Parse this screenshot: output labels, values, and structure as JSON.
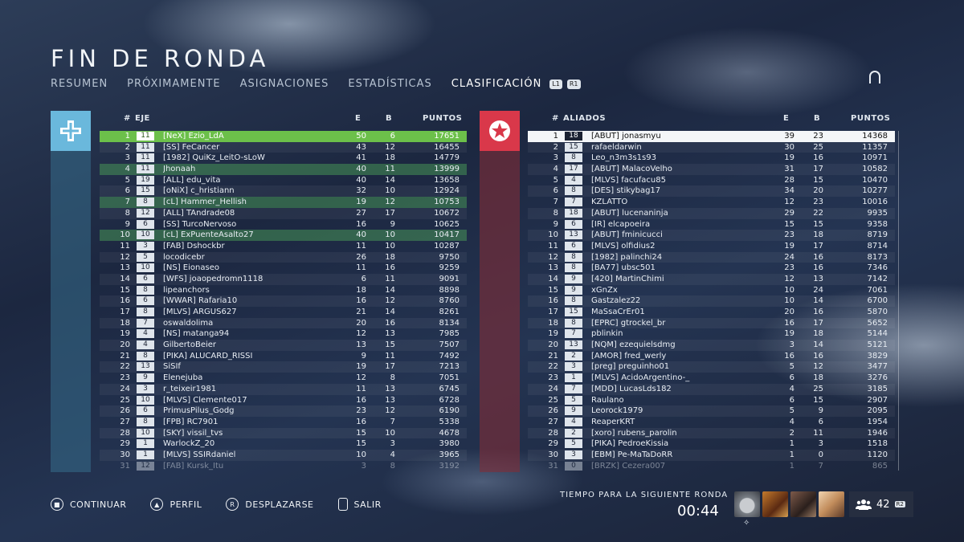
{
  "header": {
    "title": "FIN DE RONDA",
    "tabs": [
      "RESUMEN",
      "PRÓXIMAMENTE",
      "ASIGNACIONES",
      "ESTADÍSTICAS",
      "CLASIFICACIÓN"
    ],
    "active_tab": "CLASIFICACIÓN",
    "tab_buttons": [
      "L1",
      "R1"
    ]
  },
  "left_team": {
    "color": "#6ab8dc",
    "icon": "axis-cross-emblem-icon",
    "columns": {
      "rank": "#",
      "name": "EJE",
      "e": "E",
      "b": "B",
      "pts": "PUNTOS"
    },
    "rows": [
      {
        "rank": "1",
        "sq": "11",
        "name": "[NeX] Ezio_LdA",
        "e": "50",
        "b": "6",
        "pts": "17651",
        "style": "me"
      },
      {
        "rank": "2",
        "sq": "11",
        "name": "[SS] FeCancer",
        "e": "43",
        "b": "12",
        "pts": "16455"
      },
      {
        "rank": "3",
        "sq": "11",
        "name": "[1982] QuiKz_LeitO-sLoW",
        "e": "41",
        "b": "18",
        "pts": "14779"
      },
      {
        "rank": "4",
        "sq": "11",
        "name": "Jhonaah",
        "e": "40",
        "b": "11",
        "pts": "13999",
        "style": "hl"
      },
      {
        "rank": "5",
        "sq": "19",
        "name": "[ALL] edu_vita",
        "e": "40",
        "b": "14",
        "pts": "13658"
      },
      {
        "rank": "6",
        "sq": "15",
        "name": "[oNiX] c_hristiann",
        "e": "32",
        "b": "10",
        "pts": "12924"
      },
      {
        "rank": "7",
        "sq": "8",
        "name": "[cL] Hammer_Hellish",
        "e": "19",
        "b": "12",
        "pts": "10753",
        "style": "hl"
      },
      {
        "rank": "8",
        "sq": "12",
        "name": "[ALL] TAndrade08",
        "e": "27",
        "b": "17",
        "pts": "10672"
      },
      {
        "rank": "9",
        "sq": "6",
        "name": "[SS] TurcoNervoso",
        "e": "16",
        "b": "9",
        "pts": "10625"
      },
      {
        "rank": "10",
        "sq": "10",
        "name": "[cL] ExPuenteAsalto27",
        "e": "40",
        "b": "10",
        "pts": "10417",
        "style": "hl"
      },
      {
        "rank": "11",
        "sq": "3",
        "name": "[FAB] Dshockbr",
        "e": "11",
        "b": "10",
        "pts": "10287"
      },
      {
        "rank": "12",
        "sq": "5",
        "name": "locodicebr",
        "e": "26",
        "b": "18",
        "pts": "9750"
      },
      {
        "rank": "13",
        "sq": "10",
        "name": "[NS] Eionaseo",
        "e": "11",
        "b": "16",
        "pts": "9259"
      },
      {
        "rank": "14",
        "sq": "6",
        "name": "[WFS] joaopedromn1118",
        "e": "6",
        "b": "11",
        "pts": "9091"
      },
      {
        "rank": "15",
        "sq": "8",
        "name": "lipeanchors",
        "e": "18",
        "b": "14",
        "pts": "8898"
      },
      {
        "rank": "16",
        "sq": "6",
        "name": "[WWAR] Rafaria10",
        "e": "16",
        "b": "12",
        "pts": "8760"
      },
      {
        "rank": "17",
        "sq": "8",
        "name": "[MLVS] ARGUS627",
        "e": "21",
        "b": "14",
        "pts": "8261"
      },
      {
        "rank": "18",
        "sq": "7",
        "name": "oswaldolima",
        "e": "20",
        "b": "16",
        "pts": "8134"
      },
      {
        "rank": "19",
        "sq": "4",
        "name": "[NS] matanga94",
        "e": "12",
        "b": "13",
        "pts": "7985"
      },
      {
        "rank": "20",
        "sq": "4",
        "name": "GilbertoBeier",
        "e": "13",
        "b": "15",
        "pts": "7507"
      },
      {
        "rank": "21",
        "sq": "8",
        "name": "[PIKA] ALUCARD_RISSI",
        "e": "9",
        "b": "11",
        "pts": "7492"
      },
      {
        "rank": "22",
        "sq": "13",
        "name": "SiSIf",
        "e": "19",
        "b": "17",
        "pts": "7213"
      },
      {
        "rank": "23",
        "sq": "9",
        "name": "Elenejuba",
        "e": "12",
        "b": "8",
        "pts": "7051"
      },
      {
        "rank": "24",
        "sq": "3",
        "name": "r_teixeir1981",
        "e": "11",
        "b": "13",
        "pts": "6745"
      },
      {
        "rank": "25",
        "sq": "10",
        "name": "[MLVS] Clemente017",
        "e": "16",
        "b": "13",
        "pts": "6728"
      },
      {
        "rank": "26",
        "sq": "6",
        "name": "PrimusPilus_Godg",
        "e": "23",
        "b": "12",
        "pts": "6190"
      },
      {
        "rank": "27",
        "sq": "8",
        "name": "[FPB] RC7901",
        "e": "16",
        "b": "7",
        "pts": "5338"
      },
      {
        "rank": "28",
        "sq": "10",
        "name": "[SKY] vissil_tvs",
        "e": "15",
        "b": "10",
        "pts": "4678"
      },
      {
        "rank": "29",
        "sq": "1",
        "name": "WarlockZ_20",
        "e": "15",
        "b": "3",
        "pts": "3980"
      },
      {
        "rank": "30",
        "sq": "1",
        "name": "[MLVS] SSIRdaniel",
        "e": "10",
        "b": "4",
        "pts": "3965"
      },
      {
        "rank": "31",
        "sq": "12",
        "name": "[FAB] Kursk_Itu",
        "e": "3",
        "b": "8",
        "pts": "3192",
        "style": "fade"
      }
    ]
  },
  "right_team": {
    "color": "#d9384a",
    "icon": "allies-star-emblem-icon",
    "columns": {
      "rank": "#",
      "name": "ALIADOS",
      "e": "E",
      "b": "B",
      "pts": "PUNTOS"
    },
    "rows": [
      {
        "rank": "1",
        "sq": "18",
        "name": "[ABUT] jonasmyu",
        "e": "39",
        "b": "23",
        "pts": "14368",
        "style": "top"
      },
      {
        "rank": "2",
        "sq": "15",
        "name": "rafaeldarwin",
        "e": "30",
        "b": "25",
        "pts": "11357"
      },
      {
        "rank": "3",
        "sq": "8",
        "name": "Leo_n3m3s1s93",
        "e": "19",
        "b": "16",
        "pts": "10971"
      },
      {
        "rank": "4",
        "sq": "17",
        "name": "[ABUT] MalacoVelho",
        "e": "31",
        "b": "17",
        "pts": "10582"
      },
      {
        "rank": "5",
        "sq": "4",
        "name": "[MLVS] facufacu85",
        "e": "28",
        "b": "15",
        "pts": "10470"
      },
      {
        "rank": "6",
        "sq": "8",
        "name": "[DES] stikybag17",
        "e": "34",
        "b": "20",
        "pts": "10277"
      },
      {
        "rank": "7",
        "sq": "7",
        "name": "KZLATTO",
        "e": "12",
        "b": "23",
        "pts": "10016"
      },
      {
        "rank": "8",
        "sq": "18",
        "name": "[ABUT] lucenaninja",
        "e": "29",
        "b": "22",
        "pts": "9935"
      },
      {
        "rank": "9",
        "sq": "6",
        "name": "[IR] elcapoeira",
        "e": "15",
        "b": "15",
        "pts": "9358"
      },
      {
        "rank": "10",
        "sq": "13",
        "name": "[ABUT] fminicucci",
        "e": "23",
        "b": "18",
        "pts": "8719"
      },
      {
        "rank": "11",
        "sq": "6",
        "name": "[MLVS] olfidius2",
        "e": "19",
        "b": "17",
        "pts": "8714"
      },
      {
        "rank": "12",
        "sq": "8",
        "name": "[1982] palinchi24",
        "e": "24",
        "b": "16",
        "pts": "8173"
      },
      {
        "rank": "13",
        "sq": "8",
        "name": "[BA77] ubsc501",
        "e": "23",
        "b": "16",
        "pts": "7346"
      },
      {
        "rank": "14",
        "sq": "9",
        "name": "[420] MartinChimi",
        "e": "12",
        "b": "13",
        "pts": "7142"
      },
      {
        "rank": "15",
        "sq": "9",
        "name": "xGnZx",
        "e": "10",
        "b": "24",
        "pts": "7061"
      },
      {
        "rank": "16",
        "sq": "8",
        "name": "Gastzalez22",
        "e": "10",
        "b": "14",
        "pts": "6700"
      },
      {
        "rank": "17",
        "sq": "15",
        "name": "MaSsaCrEr01",
        "e": "20",
        "b": "16",
        "pts": "5870"
      },
      {
        "rank": "18",
        "sq": "8",
        "name": "[EPRC] gtrockel_br",
        "e": "16",
        "b": "17",
        "pts": "5652"
      },
      {
        "rank": "19",
        "sq": "7",
        "name": "pblinkin",
        "e": "19",
        "b": "18",
        "pts": "5144"
      },
      {
        "rank": "20",
        "sq": "13",
        "name": "[NQM] ezequielsdmg",
        "e": "3",
        "b": "14",
        "pts": "5121"
      },
      {
        "rank": "21",
        "sq": "2",
        "name": "[AMOR] fred_werly",
        "e": "16",
        "b": "16",
        "pts": "3829"
      },
      {
        "rank": "22",
        "sq": "3",
        "name": "[preg] preguinho01",
        "e": "5",
        "b": "12",
        "pts": "3477"
      },
      {
        "rank": "23",
        "sq": "1",
        "name": "[MLVS] AcidoArgentino-_",
        "e": "6",
        "b": "18",
        "pts": "3276"
      },
      {
        "rank": "24",
        "sq": "7",
        "name": "[MDD] LucasLds182",
        "e": "4",
        "b": "25",
        "pts": "3185"
      },
      {
        "rank": "25",
        "sq": "5",
        "name": "Raulano",
        "e": "6",
        "b": "15",
        "pts": "2907"
      },
      {
        "rank": "26",
        "sq": "9",
        "name": "Leorock1979",
        "e": "5",
        "b": "9",
        "pts": "2095"
      },
      {
        "rank": "27",
        "sq": "4",
        "name": "ReaperKRT",
        "e": "4",
        "b": "6",
        "pts": "1954"
      },
      {
        "rank": "28",
        "sq": "2",
        "name": "[xoro] rubens_parolin",
        "e": "2",
        "b": "11",
        "pts": "1946"
      },
      {
        "rank": "29",
        "sq": "5",
        "name": "[PIKA] PedroeKissia",
        "e": "1",
        "b": "3",
        "pts": "1518"
      },
      {
        "rank": "30",
        "sq": "3",
        "name": "[EBM] Pe-MaTaDoRR",
        "e": "1",
        "b": "0",
        "pts": "1120"
      },
      {
        "rank": "31",
        "sq": "0",
        "name": "[BRZK] Cezera007",
        "e": "1",
        "b": "7",
        "pts": "865",
        "style": "fade"
      }
    ]
  },
  "footer": {
    "buttons": [
      {
        "icon": "square-button-icon",
        "label": "CONTINUAR"
      },
      {
        "icon": "triangle-button-icon",
        "label": "PERFIL"
      },
      {
        "icon": "r-stick-button-icon",
        "label": "DESPLAZARSE"
      },
      {
        "icon": "options-button-icon",
        "label": "SALIR"
      }
    ],
    "next_round_label": "TIEMPO PARA LA SIGUIENTE RONDA",
    "timer": "00:44",
    "player_count": "42",
    "player_button": "R2"
  }
}
